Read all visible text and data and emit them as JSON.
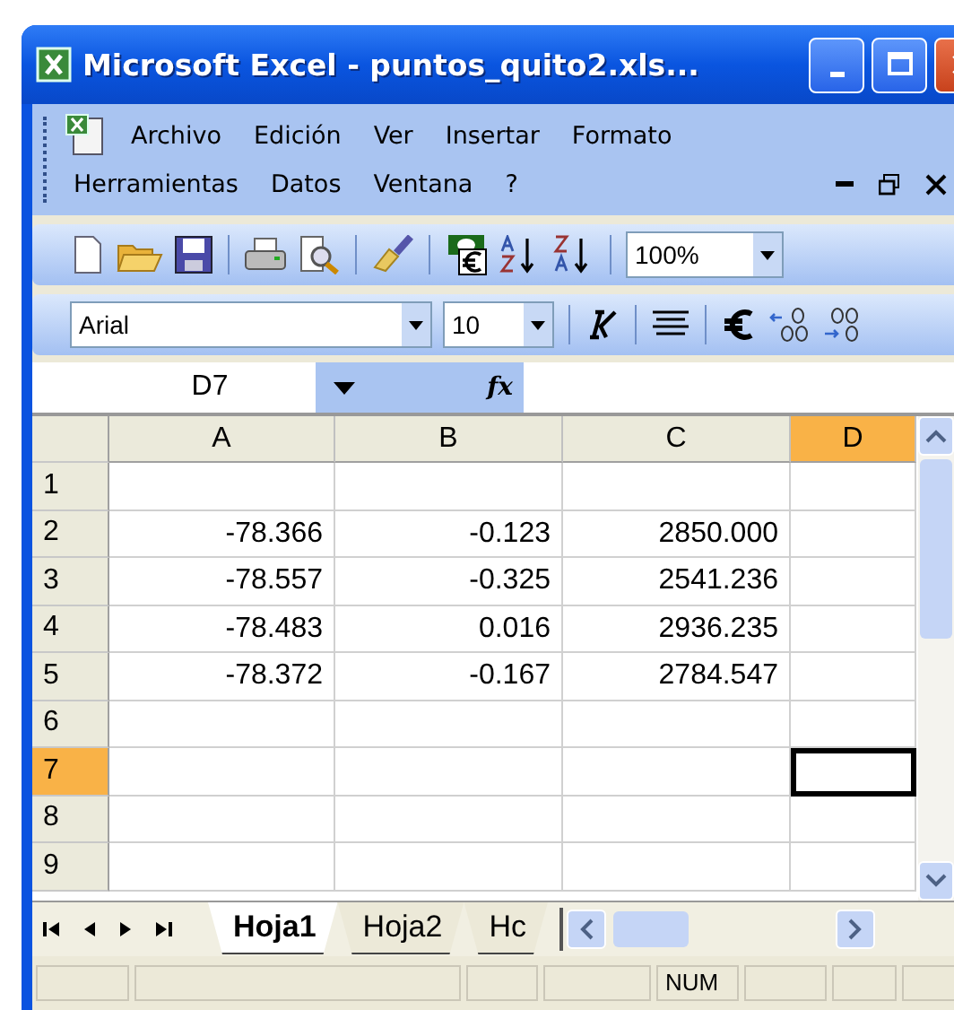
{
  "window": {
    "title": "Microsoft Excel - puntos_quito2.xls..."
  },
  "menu": {
    "rows": [
      [
        "Archivo",
        "Edición",
        "Ver",
        "Insertar",
        "Formato"
      ],
      [
        "Herramientas",
        "Datos",
        "Ventana",
        "?"
      ]
    ]
  },
  "standard_toolbar": {
    "zoom": "100%"
  },
  "formatting_toolbar": {
    "font": "Arial",
    "size": "10"
  },
  "formula_bar": {
    "name_box": "D7",
    "function_label": "fx"
  },
  "sheet": {
    "columns": [
      {
        "label": "A",
        "selected": false
      },
      {
        "label": "B",
        "selected": false
      },
      {
        "label": "C",
        "selected": false
      },
      {
        "label": "D",
        "selected": true
      }
    ],
    "rows": [
      {
        "label": "1",
        "selected": false,
        "cells": []
      },
      {
        "label": "2",
        "selected": false,
        "cells": [
          "-78.366",
          "-0.123",
          "2850.000"
        ]
      },
      {
        "label": "3",
        "selected": false,
        "cells": [
          "-78.557",
          "-0.325",
          "2541.236"
        ]
      },
      {
        "label": "4",
        "selected": false,
        "cells": [
          "-78.483",
          "0.016",
          "2936.235"
        ]
      },
      {
        "label": "5",
        "selected": false,
        "cells": [
          "-78.372",
          "-0.167",
          "2784.547"
        ]
      },
      {
        "label": "6",
        "selected": false,
        "cells": []
      },
      {
        "label": "7",
        "selected": true,
        "cells": []
      },
      {
        "label": "8",
        "selected": false,
        "cells": []
      },
      {
        "label": "9",
        "selected": false,
        "cells": []
      }
    ]
  },
  "sheet_tabs": [
    {
      "label": "Hoja1",
      "selected": true
    },
    {
      "label": "Hoja2",
      "selected": false
    },
    {
      "label": "Hc",
      "selected": false
    }
  ],
  "status_bar": {
    "indicator": "NUM"
  }
}
